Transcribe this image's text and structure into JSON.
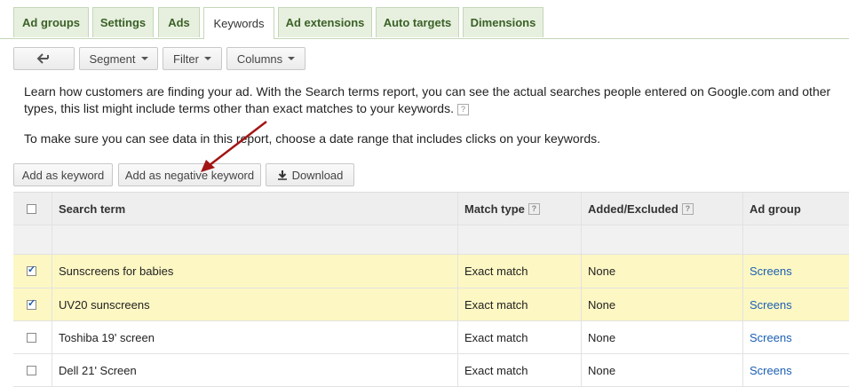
{
  "tabs": [
    {
      "label": "Ad groups",
      "active": false
    },
    {
      "label": "Settings",
      "active": false
    },
    {
      "label": "Ads",
      "active": false
    },
    {
      "label": "Keywords",
      "active": true
    },
    {
      "label": "Ad extensions",
      "active": false
    },
    {
      "label": "Auto targets",
      "active": false
    },
    {
      "label": "Dimensions",
      "active": false
    }
  ],
  "toolbar": {
    "back_icon": "back-arrow-icon",
    "segment": "Segment",
    "filter": "Filter",
    "columns": "Columns"
  },
  "info": {
    "line1": "Learn how customers are finding your ad. With the Search terms report, you can see the actual searches people entered on Google.com and other",
    "line2": "types, this list might include terms other than exact matches to your keywords.",
    "line3": "To make sure you can see data in this report, choose a date range that includes clicks on your keywords."
  },
  "actions": {
    "add_keyword": "Add as keyword",
    "add_negative": "Add as negative keyword",
    "download": "Download"
  },
  "table": {
    "headers": {
      "search_term": "Search term",
      "match_type": "Match type",
      "added_excluded": "Added/Excluded",
      "ad_group": "Ad group"
    },
    "rows": [
      {
        "checked": true,
        "term": "Sunscreens for babies",
        "match": "Exact match",
        "added": "None",
        "group": "Screens"
      },
      {
        "checked": true,
        "term": "UV20 sunscreens",
        "match": "Exact match",
        "added": "None",
        "group": "Screens"
      },
      {
        "checked": false,
        "term": "Toshiba 19' screen",
        "match": "Exact match",
        "added": "None",
        "group": "Screens"
      },
      {
        "checked": false,
        "term": "Dell 21' Screen",
        "match": "Exact match",
        "added": "None",
        "group": "Screens"
      }
    ]
  },
  "colors": {
    "accent": "#3b6127",
    "highlight": "#fdf7c3",
    "link": "#1a5fb4",
    "arrow": "#a31515"
  }
}
